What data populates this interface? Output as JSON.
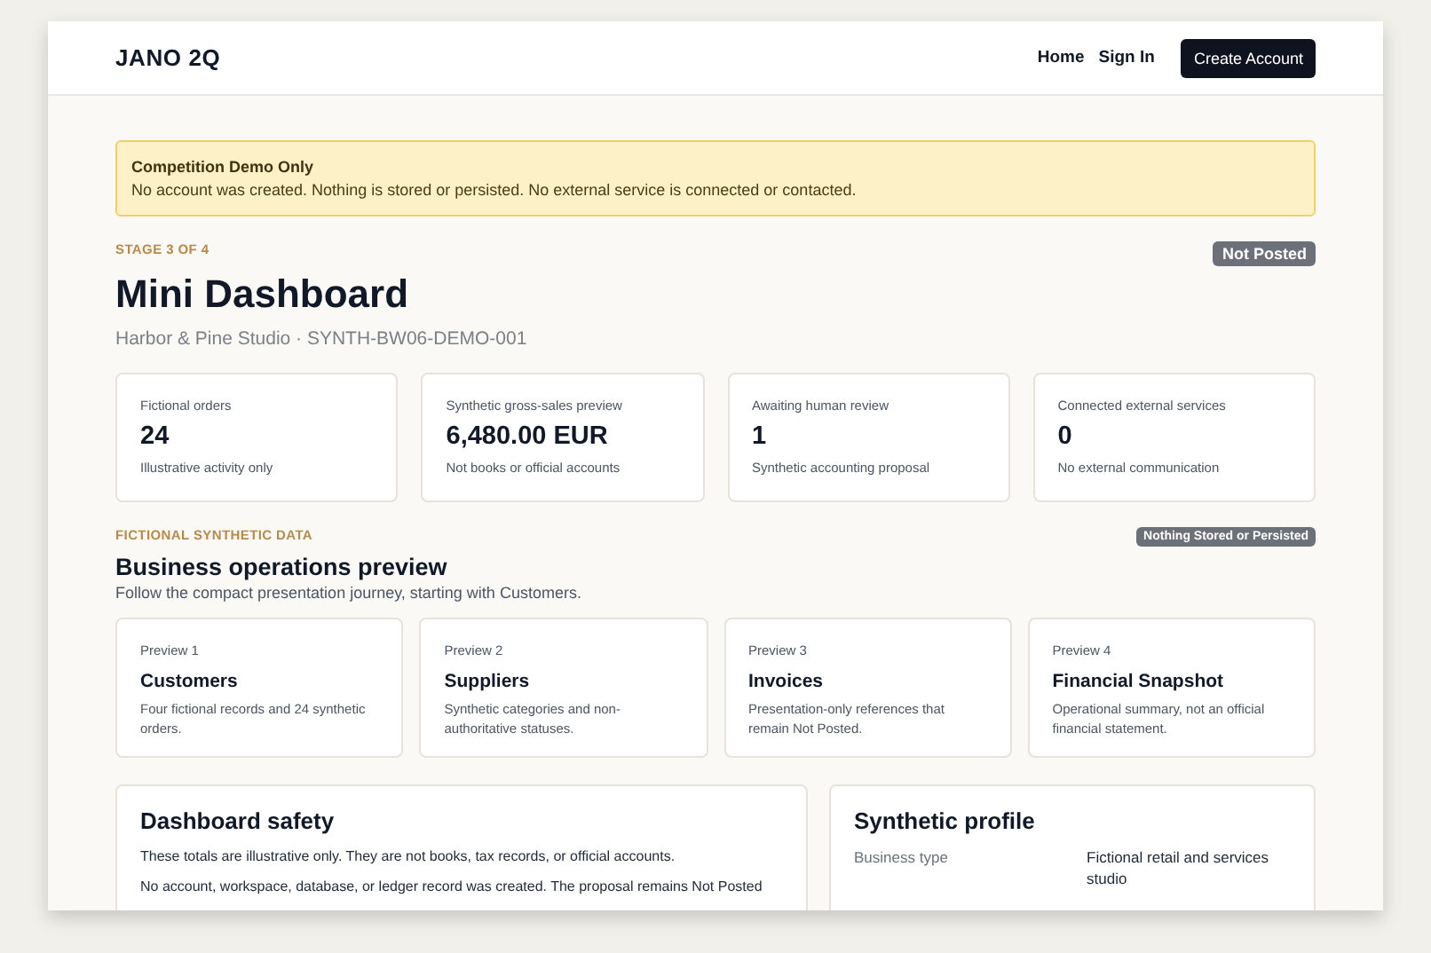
{
  "header": {
    "brand": "JANO 2Q",
    "nav": [
      {
        "label": "Home"
      },
      {
        "label": "Sign In"
      }
    ],
    "cta": "Create Account"
  },
  "notice": {
    "title": "Competition Demo Only",
    "text": "No account was created. Nothing is stored or persisted. No external service is connected or contacted."
  },
  "page": {
    "stage": "STAGE 3 OF 4",
    "title": "Mini Dashboard",
    "subtitle": "Harbor & Pine Studio · SYNTH-BW06-DEMO-001",
    "badge": "Not Posted"
  },
  "stats": [
    {
      "label": "Fictional orders",
      "value": "24",
      "note": "Illustrative activity only"
    },
    {
      "label": "Synthetic gross-sales preview",
      "value": "6,480.00 EUR",
      "note": "Not books or official accounts"
    },
    {
      "label": "Awaiting human review",
      "value": "1",
      "note": "Synthetic accounting proposal"
    },
    {
      "label": "Connected external services",
      "value": "0",
      "note": "No external communication"
    }
  ],
  "section": {
    "eyebrow": "FICTIONAL SYNTHETIC DATA",
    "badge": "Nothing Stored or Persisted",
    "title": "Business operations preview",
    "description": "Follow the compact presentation journey, starting with Customers."
  },
  "previews": [
    {
      "step": "Preview 1",
      "title": "Customers",
      "text": "Four fictional records and 24 synthetic orders."
    },
    {
      "step": "Preview 2",
      "title": "Suppliers",
      "text": "Synthetic categories and non-authoritative statuses."
    },
    {
      "step": "Preview 3",
      "title": "Invoices",
      "text": "Presentation-only references that remain Not Posted."
    },
    {
      "step": "Preview 4",
      "title": "Financial Snapshot",
      "text": "Operational summary, not an official financial statement."
    }
  ],
  "safety": {
    "title": "Dashboard safety",
    "paragraphs": [
      "These totals are illustrative only. They are not books, tax records, or official accounts.",
      "No account, workspace, database, or ledger record was created. The proposal remains Not Posted"
    ]
  },
  "profile": {
    "title": "Synthetic profile",
    "rows": [
      {
        "label": "Business type",
        "value": "Fictional retail and services studio"
      }
    ]
  }
}
